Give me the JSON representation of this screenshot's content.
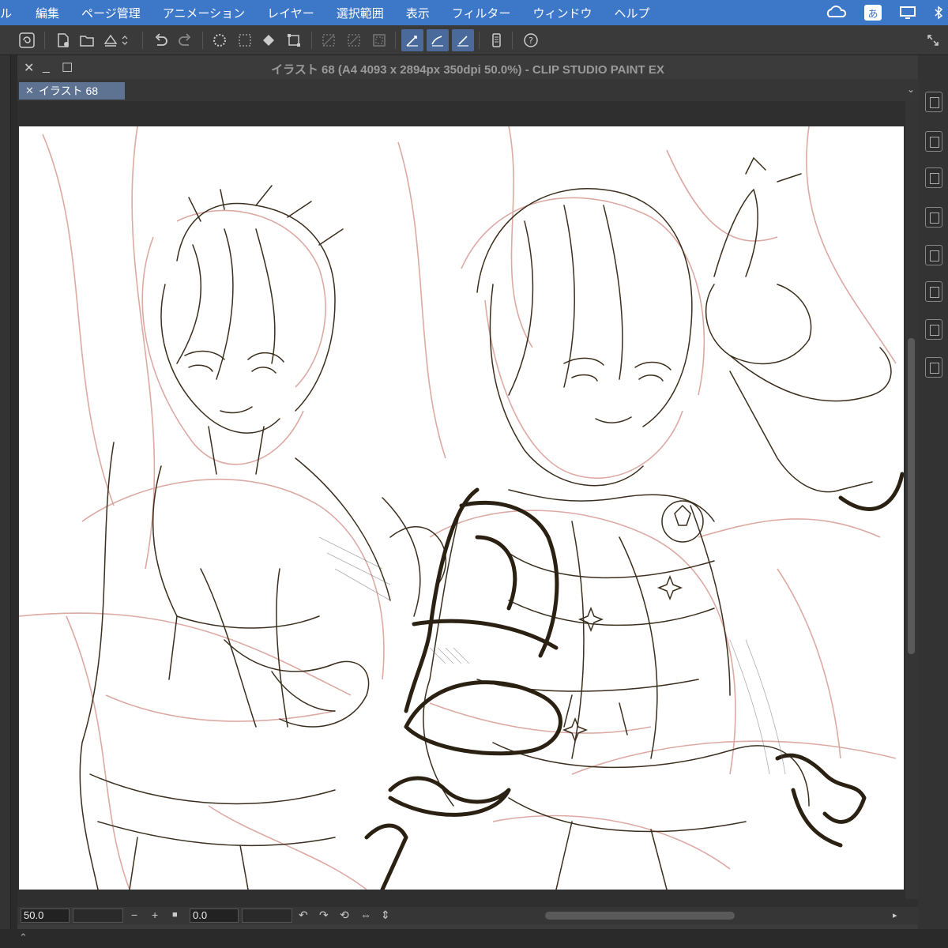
{
  "menubar": {
    "items": [
      "ル",
      "編集",
      "ページ管理",
      "アニメーション",
      "レイヤー",
      "選択範囲",
      "表示",
      "フィルター",
      "ウィンドウ",
      "ヘルプ"
    ],
    "ime_label": "あ"
  },
  "window": {
    "title": "イラスト 68 (A4 4093 x 2894px 350dpi 50.0%)  - CLIP STUDIO PAINT EX",
    "tab_label": "イラスト 68"
  },
  "statusbar": {
    "zoom": "50.0",
    "angle": "0.0"
  },
  "colors": {
    "menubar_bg": "#3d77c8",
    "tab_bg": "#5e7392",
    "sketch_dark": "#3a2e1c",
    "sketch_red": "#d9a09a"
  }
}
